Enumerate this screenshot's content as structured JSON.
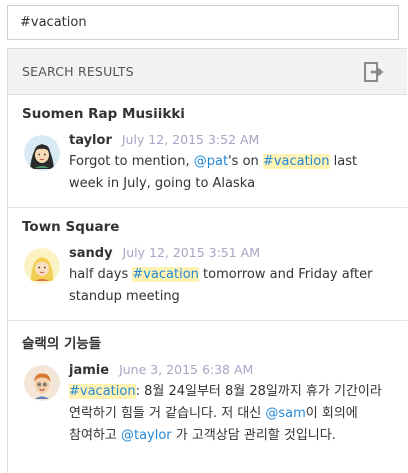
{
  "search": {
    "value": "#vacation"
  },
  "results_header": {
    "title": "SEARCH RESULTS",
    "expand_icon": "expand-sidebar-icon"
  },
  "colors": {
    "link": "#2389d7",
    "highlight": "#fff3b3",
    "timestamp": "#a6a6c6"
  },
  "results": [
    {
      "channel": "Suomen Rap Musiikki",
      "user": "taylor",
      "time": "July 12, 2015 3:52 AM",
      "avatar": "female-avatar-dark-hair",
      "message": {
        "t1": "Forgot to mention, ",
        "mention": "@pat",
        "t2": "'s on ",
        "hashtag": "#vacation",
        "t3": " last week in July, going to Alaska"
      }
    },
    {
      "channel": "Town Square",
      "user": "sandy",
      "time": "July 12, 2015 3:51 AM",
      "avatar": "female-avatar-blonde",
      "message": {
        "t1": "half days ",
        "hashtag": "#vacation",
        "t2": " tomorrow and Friday after standup meeting"
      }
    },
    {
      "channel": "슬랙의 기능들",
      "user": "jamie",
      "time": "June 3, 2015 6:38 AM",
      "avatar": "male-avatar-orange-hair",
      "message": {
        "hashtag": "#vacation",
        "t1": ": 8월 24일부터 8월 28일까지 휴가 기간이라 연락하기 힘들 거 같습니다. 저 대신 ",
        "mention1": "@sam",
        "t2": "이 회의에 참여하고 ",
        "mention2": "@taylor",
        "t3": " 가 고객상담 관리할 것입니다."
      }
    }
  ]
}
